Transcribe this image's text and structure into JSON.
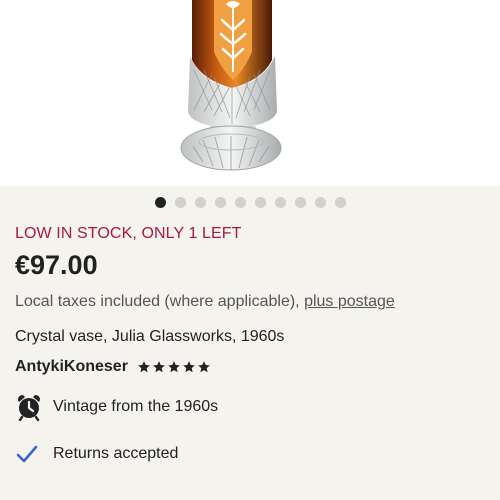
{
  "carousel": {
    "total": 10,
    "active": 0
  },
  "listing": {
    "stock_notice": "LOW IN STOCK, ONLY 1 LEFT",
    "price": "€97.00",
    "tax_text": "Local taxes included (where applicable), ",
    "postage_link": "plus postage",
    "title": "Crystal vase, Julia Glassworks, 1960s",
    "seller": "AntykiKoneser",
    "rating_stars": 5,
    "features": {
      "vintage": "Vintage from the 1960s",
      "returns": "Returns accepted"
    }
  },
  "colors": {
    "stock_notice": "#a61a44",
    "check": "#3b67c7",
    "active_dot": "#222222",
    "inactive_dot": "#d2d0cb"
  },
  "icons": {
    "vintage": "alarm-clock-icon",
    "returns": "checkmark-icon",
    "rating": "star-icon"
  }
}
